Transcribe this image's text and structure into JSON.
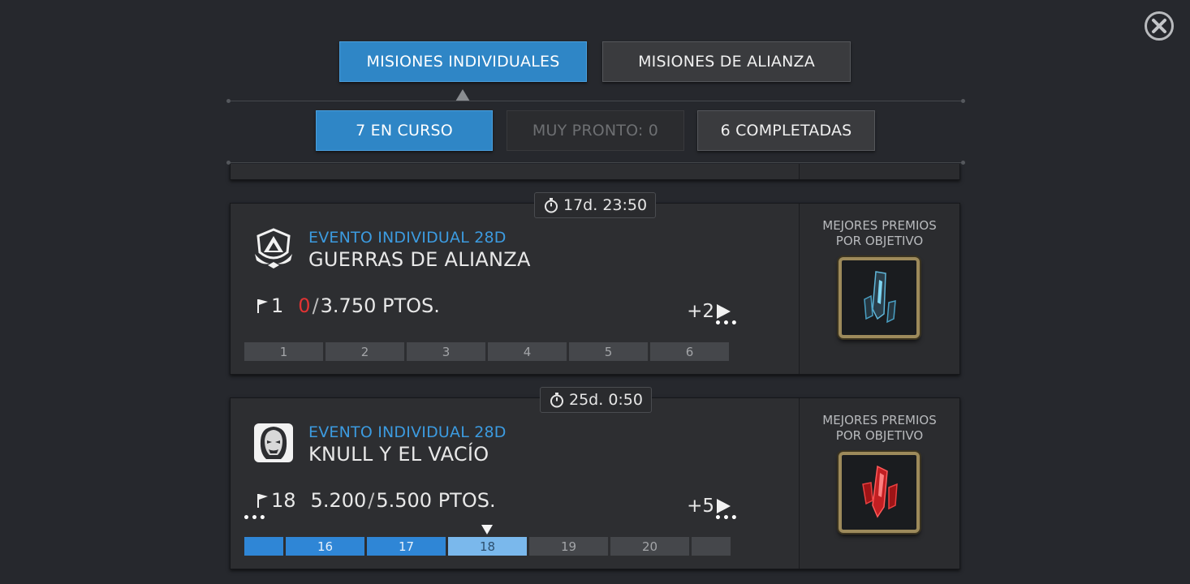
{
  "tabs_main": [
    {
      "label": "MISIONES INDIVIDUALES",
      "active": true
    },
    {
      "label": "MISIONES DE ALIANZA",
      "active": false
    }
  ],
  "tabs_sub": [
    {
      "label": "7 EN CURSO",
      "state": "active"
    },
    {
      "label": "MUY PRONTO: 0",
      "state": "disabled"
    },
    {
      "label": "6 COMPLETADAS",
      "state": "inactive"
    }
  ],
  "events": [
    {
      "timer": "17d. 23:50",
      "icon": "alliance-war-emblem-icon",
      "label": "EVENTO INDIVIDUAL 28D",
      "title": "GUERRAS DE ALIANZA",
      "milestone": "1",
      "points_current": "0",
      "points_target": "3.750 PTOS.",
      "more_rewards": "+2",
      "milestones": [
        "1",
        "2",
        "3",
        "4",
        "5",
        "6"
      ],
      "rewards_title": [
        "MEJORES PREMIOS",
        "POR OBJETIVO"
      ],
      "reward_icon": "blue-crystal-icon"
    },
    {
      "timer": "25d. 0:50",
      "icon": "knull-portrait-icon",
      "label": "EVENTO INDIVIDUAL 28D",
      "title": "KNULL Y EL VACÍO",
      "milestone": "18",
      "points_current": "5.200",
      "points_target": "5.500 PTOS.",
      "more_rewards": "+5",
      "milestones": [
        "",
        "16",
        "17",
        "18",
        "19",
        "20",
        ""
      ],
      "milestones_done": 3,
      "milestone_current_index": 3,
      "rewards_title": [
        "MEJORES PREMIOS",
        "POR OBJETIVO"
      ],
      "reward_icon": "red-crystal-icon"
    }
  ],
  "colors": {
    "accent_blue": "#2f86c6",
    "label_blue": "#3c9be0",
    "warning_red": "#e03333",
    "reward_frame_gold": "#9d8a5b"
  }
}
